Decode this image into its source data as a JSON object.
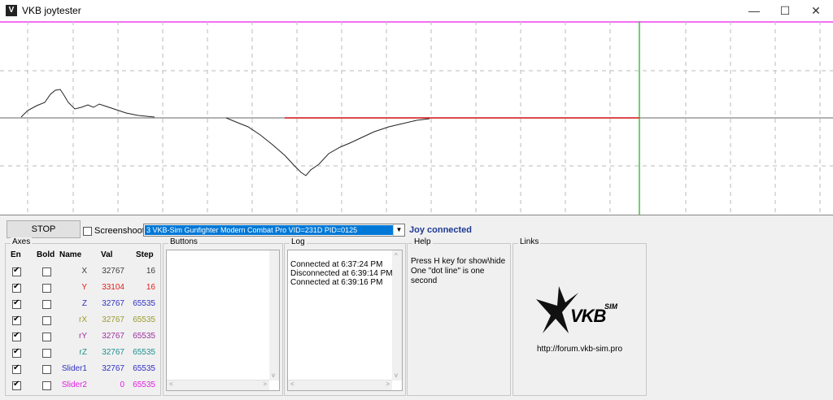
{
  "window": {
    "title": "VKB joytester",
    "minimize": "—",
    "maximize": "☐",
    "close": "✕"
  },
  "toolbar": {
    "stop_label": "STOP",
    "screenshot_label": "Screenshoot",
    "device": "3  VKB-Sim Gunfighter Modern Combat Pro  VID=231D PID=0125",
    "status": "Joy connected",
    "status_color": "#1f3a93"
  },
  "axes": {
    "group_label": "Axes",
    "headers": {
      "en": "En",
      "bold": "Bold",
      "name": "Name",
      "val": "Val",
      "step": "Step"
    },
    "rows": [
      {
        "name": "X",
        "val": "32767",
        "step": "16",
        "color": "#404040",
        "en": true,
        "bold": false
      },
      {
        "name": "Y",
        "val": "33104",
        "step": "16",
        "color": "#e02020",
        "en": true,
        "bold": false
      },
      {
        "name": "Z",
        "val": "32767",
        "step": "65535",
        "color": "#3030c0",
        "en": true,
        "bold": false
      },
      {
        "name": "rX",
        "val": "32767",
        "step": "65535",
        "color": "#9a9a30",
        "en": true,
        "bold": false
      },
      {
        "name": "rY",
        "val": "32767",
        "step": "65535",
        "color": "#a030a0",
        "en": true,
        "bold": false
      },
      {
        "name": "rZ",
        "val": "32767",
        "step": "65535",
        "color": "#209090",
        "en": true,
        "bold": false
      },
      {
        "name": "Slider1",
        "val": "32767",
        "step": "65535",
        "color": "#3030c0",
        "en": true,
        "bold": false
      },
      {
        "name": "Slider2",
        "val": "0",
        "step": "65535",
        "color": "#e020e0",
        "en": true,
        "bold": false
      }
    ]
  },
  "buttons": {
    "group_label": "Buttons"
  },
  "log": {
    "group_label": "Log",
    "lines": [
      "Connected at 6:37:24 PM",
      "Disconnected at 6:39:14 PM",
      "Connected at 6:39:16 PM"
    ]
  },
  "help": {
    "group_label": "Help",
    "line1": "Press H key for show\\hide",
    "line2": "One \"dot line\" is one second"
  },
  "links": {
    "group_label": "Links",
    "logo_main": "VKB",
    "logo_sup": "SIM",
    "url": "http://forum.vkb-sim.pro"
  },
  "icons": {
    "scroll_left": "<",
    "scroll_right": ">",
    "scroll_up": "^",
    "scroll_down": "v",
    "dropdown": "▼",
    "app": "V"
  }
}
